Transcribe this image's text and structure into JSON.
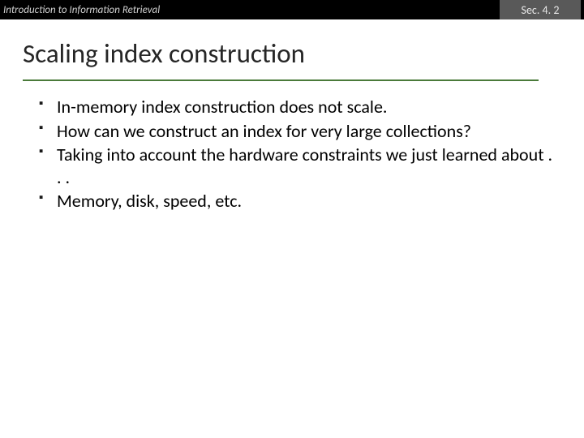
{
  "header": {
    "course_title": "Introduction to Information Retrieval",
    "section_label": "Sec. 4. 2"
  },
  "slide": {
    "title": "Scaling index construction",
    "bullets": [
      "In-memory index construction does not scale.",
      "How can we construct an index for very large collections?",
      "Taking into account the hardware constraints we just learned about . . .",
      "Memory, disk, speed, etc."
    ]
  }
}
